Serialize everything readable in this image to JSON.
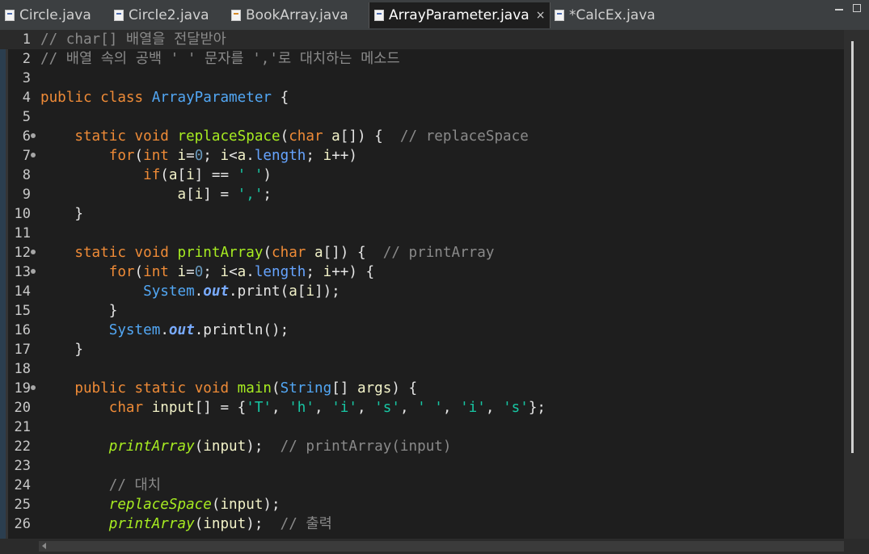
{
  "tabs": [
    {
      "label": "Circle.java",
      "active": false,
      "icon": "java-file-icon"
    },
    {
      "label": "Circle2.java",
      "active": false,
      "icon": "java-file-icon"
    },
    {
      "label": "BookArray.java",
      "active": false,
      "icon": "java-file-warning-icon"
    },
    {
      "label": "ArrayParameter.java",
      "active": true,
      "icon": "java-file-icon"
    },
    {
      "label": "*CalcEx.java",
      "active": false,
      "icon": "java-file-icon"
    }
  ],
  "close_symbol": "×",
  "editor": {
    "line_numbers": [
      "1",
      "2",
      "3",
      "4",
      "5",
      "6",
      "7",
      "8",
      "9",
      "10",
      "11",
      "12",
      "13",
      "14",
      "15",
      "16",
      "17",
      "18",
      "19",
      "20",
      "21",
      "22",
      "23",
      "24",
      "25",
      "26"
    ],
    "fold_lines": [
      "6",
      "7",
      "12",
      "13",
      "19"
    ],
    "current_line": "1",
    "lines": [
      [
        {
          "t": "cm",
          "s": "// char[] 배열을 전달받아"
        }
      ],
      [
        {
          "t": "cm",
          "s": "// 배열 속의 공백 ' ' 문자를 ','로 대치하는 메소드"
        }
      ],
      [],
      [
        {
          "t": "kw",
          "s": "public"
        },
        {
          "t": "pl",
          "s": " "
        },
        {
          "t": "kw",
          "s": "class"
        },
        {
          "t": "pl",
          "s": " "
        },
        {
          "t": "ty",
          "s": "ArrayParameter"
        },
        {
          "t": "pl",
          "s": " {"
        }
      ],
      [],
      [
        {
          "t": "pl",
          "s": "    "
        },
        {
          "t": "kw",
          "s": "static"
        },
        {
          "t": "pl",
          "s": " "
        },
        {
          "t": "kw",
          "s": "void"
        },
        {
          "t": "pl",
          "s": " "
        },
        {
          "t": "fn",
          "s": "replaceSpace"
        },
        {
          "t": "pl",
          "s": "("
        },
        {
          "t": "kw",
          "s": "char"
        },
        {
          "t": "pl",
          "s": " "
        },
        {
          "t": "id",
          "s": "a"
        },
        {
          "t": "pl",
          "s": "[]) {  "
        },
        {
          "t": "cm",
          "s": "// replaceSpace"
        }
      ],
      [
        {
          "t": "pl",
          "s": "        "
        },
        {
          "t": "kw",
          "s": "for"
        },
        {
          "t": "pl",
          "s": "("
        },
        {
          "t": "kw",
          "s": "int"
        },
        {
          "t": "pl",
          "s": " "
        },
        {
          "t": "id",
          "s": "i"
        },
        {
          "t": "pl",
          "s": "="
        },
        {
          "t": "num",
          "s": "0"
        },
        {
          "t": "pl",
          "s": "; "
        },
        {
          "t": "id",
          "s": "i"
        },
        {
          "t": "pl",
          "s": "<"
        },
        {
          "t": "id",
          "s": "a"
        },
        {
          "t": "pl",
          "s": "."
        },
        {
          "t": "fld",
          "s": "length"
        },
        {
          "t": "pl",
          "s": "; "
        },
        {
          "t": "id",
          "s": "i"
        },
        {
          "t": "pl",
          "s": "++)"
        }
      ],
      [
        {
          "t": "pl",
          "s": "            "
        },
        {
          "t": "kw",
          "s": "if"
        },
        {
          "t": "pl",
          "s": "("
        },
        {
          "t": "id",
          "s": "a"
        },
        {
          "t": "pl",
          "s": "["
        },
        {
          "t": "id",
          "s": "i"
        },
        {
          "t": "pl",
          "s": "] == "
        },
        {
          "t": "str",
          "s": "' '"
        },
        {
          "t": "pl",
          "s": ")"
        }
      ],
      [
        {
          "t": "pl",
          "s": "                "
        },
        {
          "t": "id",
          "s": "a"
        },
        {
          "t": "pl",
          "s": "["
        },
        {
          "t": "id",
          "s": "i"
        },
        {
          "t": "pl",
          "s": "] = "
        },
        {
          "t": "str",
          "s": "','"
        },
        {
          "t": "pl",
          "s": ";"
        }
      ],
      [
        {
          "t": "pl",
          "s": "    }"
        }
      ],
      [],
      [
        {
          "t": "pl",
          "s": "    "
        },
        {
          "t": "kw",
          "s": "static"
        },
        {
          "t": "pl",
          "s": " "
        },
        {
          "t": "kw",
          "s": "void"
        },
        {
          "t": "pl",
          "s": " "
        },
        {
          "t": "fn",
          "s": "printArray"
        },
        {
          "t": "pl",
          "s": "("
        },
        {
          "t": "kw",
          "s": "char"
        },
        {
          "t": "pl",
          "s": " "
        },
        {
          "t": "id",
          "s": "a"
        },
        {
          "t": "pl",
          "s": "[]) {  "
        },
        {
          "t": "cm",
          "s": "// printArray"
        }
      ],
      [
        {
          "t": "pl",
          "s": "        "
        },
        {
          "t": "kw",
          "s": "for"
        },
        {
          "t": "pl",
          "s": "("
        },
        {
          "t": "kw",
          "s": "int"
        },
        {
          "t": "pl",
          "s": " "
        },
        {
          "t": "id",
          "s": "i"
        },
        {
          "t": "pl",
          "s": "="
        },
        {
          "t": "num",
          "s": "0"
        },
        {
          "t": "pl",
          "s": "; "
        },
        {
          "t": "id",
          "s": "i"
        },
        {
          "t": "pl",
          "s": "<"
        },
        {
          "t": "id",
          "s": "a"
        },
        {
          "t": "pl",
          "s": "."
        },
        {
          "t": "fld",
          "s": "length"
        },
        {
          "t": "pl",
          "s": "; "
        },
        {
          "t": "id",
          "s": "i"
        },
        {
          "t": "pl",
          "s": "++) {"
        }
      ],
      [
        {
          "t": "pl",
          "s": "            "
        },
        {
          "t": "ty",
          "s": "System"
        },
        {
          "t": "pl",
          "s": "."
        },
        {
          "t": "sti",
          "s": "out"
        },
        {
          "t": "pl",
          "s": ".print("
        },
        {
          "t": "id",
          "s": "a"
        },
        {
          "t": "pl",
          "s": "["
        },
        {
          "t": "id",
          "s": "i"
        },
        {
          "t": "pl",
          "s": "]);"
        }
      ],
      [
        {
          "t": "pl",
          "s": "        }"
        }
      ],
      [
        {
          "t": "pl",
          "s": "        "
        },
        {
          "t": "ty",
          "s": "System"
        },
        {
          "t": "pl",
          "s": "."
        },
        {
          "t": "sti",
          "s": "out"
        },
        {
          "t": "pl",
          "s": ".println();"
        }
      ],
      [
        {
          "t": "pl",
          "s": "    }"
        }
      ],
      [],
      [
        {
          "t": "pl",
          "s": "    "
        },
        {
          "t": "kw",
          "s": "public"
        },
        {
          "t": "pl",
          "s": " "
        },
        {
          "t": "kw",
          "s": "static"
        },
        {
          "t": "pl",
          "s": " "
        },
        {
          "t": "kw",
          "s": "void"
        },
        {
          "t": "pl",
          "s": " "
        },
        {
          "t": "fn",
          "s": "main"
        },
        {
          "t": "pl",
          "s": "("
        },
        {
          "t": "ty",
          "s": "String"
        },
        {
          "t": "pl",
          "s": "[] "
        },
        {
          "t": "id",
          "s": "args"
        },
        {
          "t": "pl",
          "s": ") {"
        }
      ],
      [
        {
          "t": "pl",
          "s": "        "
        },
        {
          "t": "kw",
          "s": "char"
        },
        {
          "t": "pl",
          "s": " "
        },
        {
          "t": "id",
          "s": "input"
        },
        {
          "t": "pl",
          "s": "[] = {"
        },
        {
          "t": "str",
          "s": "'T'"
        },
        {
          "t": "pl",
          "s": ", "
        },
        {
          "t": "str",
          "s": "'h'"
        },
        {
          "t": "pl",
          "s": ", "
        },
        {
          "t": "str",
          "s": "'i'"
        },
        {
          "t": "pl",
          "s": ", "
        },
        {
          "t": "str",
          "s": "'s'"
        },
        {
          "t": "pl",
          "s": ", "
        },
        {
          "t": "str",
          "s": "' '"
        },
        {
          "t": "pl",
          "s": ", "
        },
        {
          "t": "str",
          "s": "'i'"
        },
        {
          "t": "pl",
          "s": ", "
        },
        {
          "t": "str",
          "s": "'s'"
        },
        {
          "t": "pl",
          "s": "};"
        }
      ],
      [],
      [
        {
          "t": "pl",
          "s": "        "
        },
        {
          "t": "fni",
          "s": "printArray"
        },
        {
          "t": "pl",
          "s": "("
        },
        {
          "t": "id",
          "s": "input"
        },
        {
          "t": "pl",
          "s": ");  "
        },
        {
          "t": "cm",
          "s": "// printArray(input)"
        }
      ],
      [],
      [
        {
          "t": "pl",
          "s": "        "
        },
        {
          "t": "cm",
          "s": "// 대치"
        }
      ],
      [
        {
          "t": "pl",
          "s": "        "
        },
        {
          "t": "fni",
          "s": "replaceSpace"
        },
        {
          "t": "pl",
          "s": "("
        },
        {
          "t": "id",
          "s": "input"
        },
        {
          "t": "pl",
          "s": ");"
        }
      ],
      [
        {
          "t": "pl",
          "s": "        "
        },
        {
          "t": "fni",
          "s": "printArray"
        },
        {
          "t": "pl",
          "s": "("
        },
        {
          "t": "id",
          "s": "input"
        },
        {
          "t": "pl",
          "s": ");  "
        },
        {
          "t": "cm",
          "s": "// 출력"
        }
      ]
    ]
  },
  "colors": {
    "background": "#1e1e1e",
    "keyword": "#ef8b37",
    "comment": "#8a8a8a",
    "method": "#a7ec21",
    "type": "#52a7f4",
    "string": "#17c6a3"
  }
}
